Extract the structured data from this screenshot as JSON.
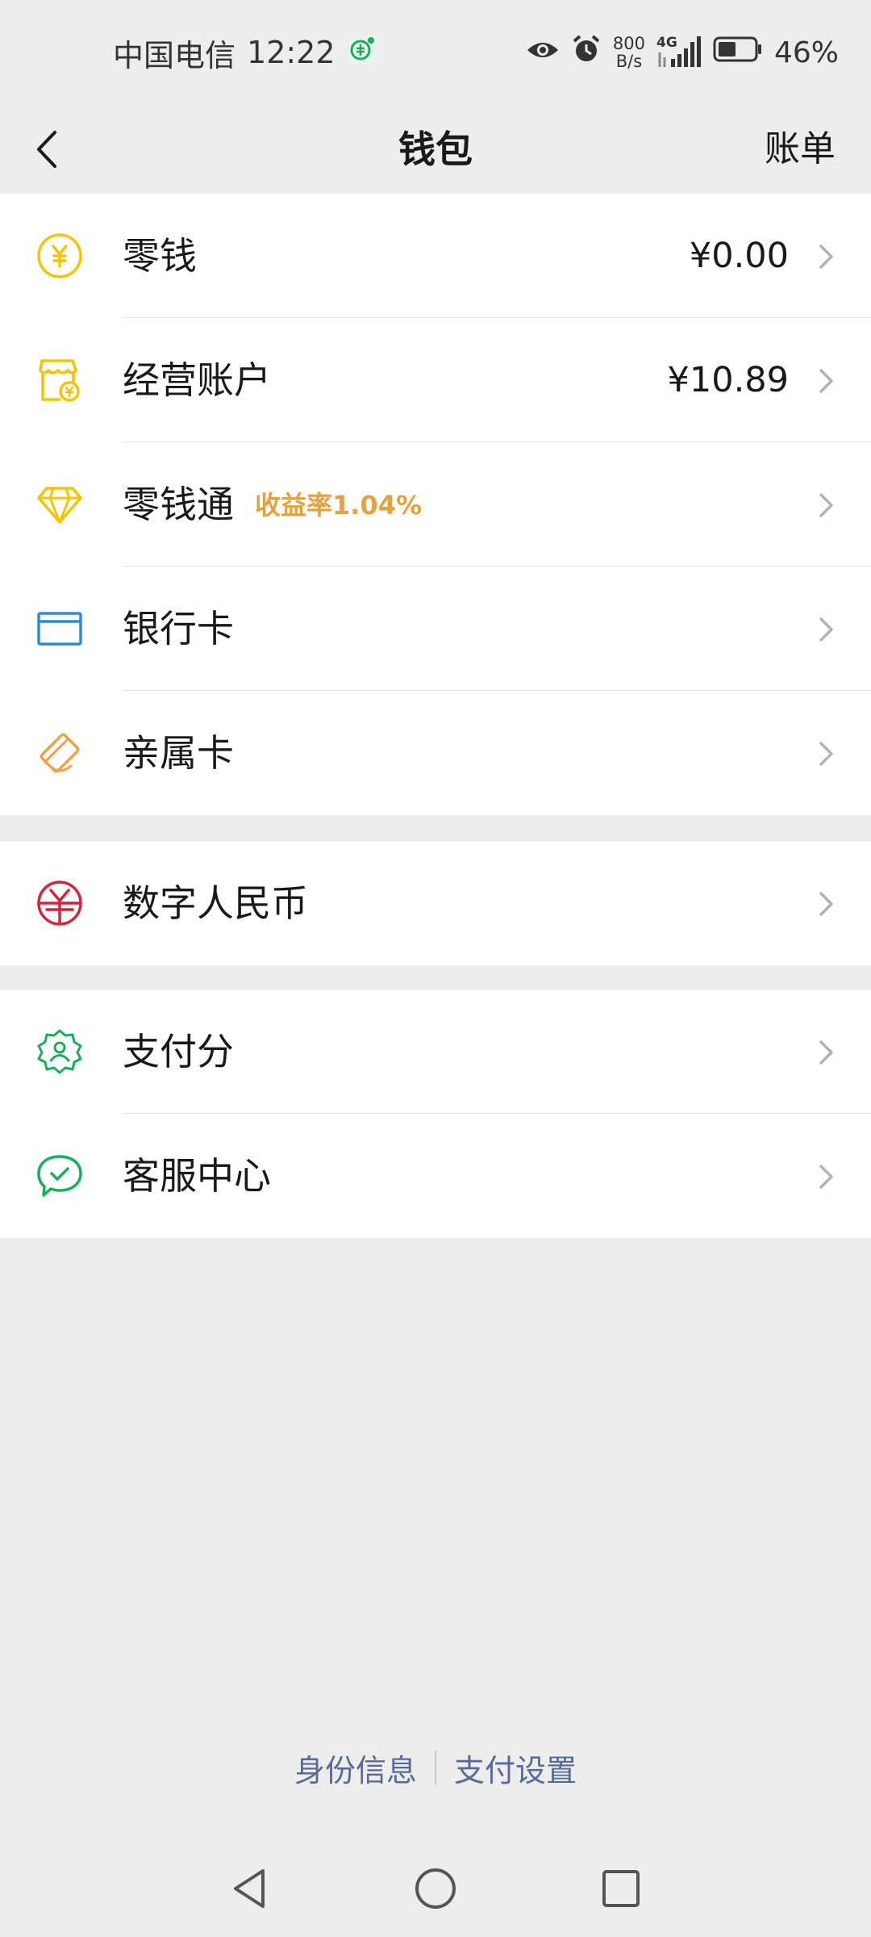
{
  "status_bar": {
    "carrier": "中国电信",
    "time": "12:22",
    "net_speed_value": "800",
    "net_speed_unit": "B/s",
    "network_type": "4G",
    "battery": "46%"
  },
  "nav": {
    "title": "钱包",
    "action": "账单"
  },
  "groups": [
    {
      "items": [
        {
          "label": "零钱",
          "value": "¥0.00",
          "icon": "yuan-coin-icon",
          "color": "#f5c400"
        },
        {
          "label": "经营账户",
          "value": "¥10.89",
          "icon": "shop-account-icon",
          "color": "#f5c400"
        },
        {
          "label": "零钱通",
          "badge": "收益率1.04%",
          "icon": "diamond-icon",
          "color": "#f5c400"
        },
        {
          "label": "银行卡",
          "icon": "bank-card-icon",
          "color": "#2b8cd6"
        },
        {
          "label": "亲属卡",
          "icon": "family-card-icon",
          "color": "#f0a04b"
        }
      ]
    },
    {
      "items": [
        {
          "label": "数字人民币",
          "icon": "digital-rmb-icon",
          "color": "#d4243a"
        }
      ]
    },
    {
      "items": [
        {
          "label": "支付分",
          "icon": "pay-score-icon",
          "color": "#1aad5b"
        },
        {
          "label": "客服中心",
          "icon": "customer-service-icon",
          "color": "#1aad5b"
        }
      ]
    }
  ],
  "footer": {
    "identity": "身份信息",
    "pay_settings": "支付设置"
  },
  "colors": {
    "background": "#ededed",
    "link": "#576b95",
    "badge": "#e8a13a"
  }
}
